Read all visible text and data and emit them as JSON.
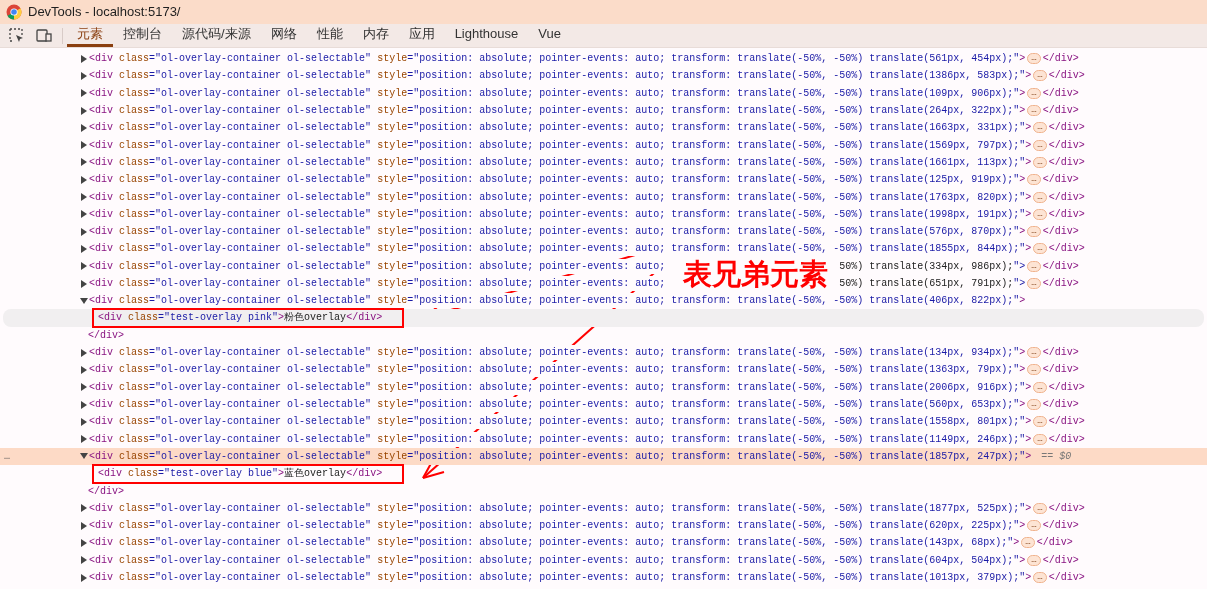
{
  "window": {
    "title": "DevTools - localhost:5173/"
  },
  "tabs": [
    {
      "label": "元素",
      "selected": true
    },
    {
      "label": "控制台",
      "selected": false
    },
    {
      "label": "源代码/来源",
      "selected": false
    },
    {
      "label": "网络",
      "selected": false
    },
    {
      "label": "性能",
      "selected": false
    },
    {
      "label": "内存",
      "selected": false
    },
    {
      "label": "应用",
      "selected": false
    },
    {
      "label": "Lighthouse",
      "selected": false
    },
    {
      "label": "Vue",
      "selected": false
    }
  ],
  "dom_rows": [
    {
      "kind": "element",
      "expanded": false,
      "selected": false,
      "text": "<div class=\"ol-overlay-container ol-selectable\" style=\"position: absolute; pointer-events: auto; transform: translate(-50%, -50%) translate(561px, 454px);\">",
      "badge": "…",
      "close": "</div>"
    },
    {
      "kind": "element",
      "expanded": false,
      "selected": false,
      "text": "<div class=\"ol-overlay-container ol-selectable\" style=\"position: absolute; pointer-events: auto; transform: translate(-50%, -50%) translate(1386px, 583px);\">",
      "badge": "…",
      "close": "</div>"
    },
    {
      "kind": "element",
      "expanded": false,
      "selected": false,
      "text": "<div class=\"ol-overlay-container ol-selectable\" style=\"position: absolute; pointer-events: auto; transform: translate(-50%, -50%) translate(109px, 906px);\">",
      "badge": "…",
      "close": "</div>"
    },
    {
      "kind": "element",
      "expanded": false,
      "selected": false,
      "text": "<div class=\"ol-overlay-container ol-selectable\" style=\"position: absolute; pointer-events: auto; transform: translate(-50%, -50%) translate(264px, 322px);\">",
      "badge": "…",
      "close": "</div>"
    },
    {
      "kind": "element",
      "expanded": false,
      "selected": false,
      "text": "<div class=\"ol-overlay-container ol-selectable\" style=\"position: absolute; pointer-events: auto; transform: translate(-50%, -50%) translate(1663px, 331px);\">",
      "badge": "…",
      "close": "</div>"
    },
    {
      "kind": "element",
      "expanded": false,
      "selected": false,
      "text": "<div class=\"ol-overlay-container ol-selectable\" style=\"position: absolute; pointer-events: auto; transform: translate(-50%, -50%) translate(1569px, 797px);\">",
      "badge": "…",
      "close": "</div>"
    },
    {
      "kind": "element",
      "expanded": false,
      "selected": false,
      "text": "<div class=\"ol-overlay-container ol-selectable\" style=\"position: absolute; pointer-events: auto; transform: translate(-50%, -50%) translate(1661px, 113px);\">",
      "badge": "…",
      "close": "</div>"
    },
    {
      "kind": "element",
      "expanded": false,
      "selected": false,
      "text": "<div class=\"ol-overlay-container ol-selectable\" style=\"position: absolute; pointer-events: auto; transform: translate(-50%, -50%) translate(125px, 919px);\">",
      "badge": "…",
      "close": "</div>"
    },
    {
      "kind": "element",
      "expanded": false,
      "selected": false,
      "text": "<div class=\"ol-overlay-container ol-selectable\" style=\"position: absolute; pointer-events: auto; transform: translate(-50%, -50%) translate(1763px, 820px);\">",
      "badge": "…",
      "close": "</div>"
    },
    {
      "kind": "element",
      "expanded": false,
      "selected": false,
      "text": "<div class=\"ol-overlay-container ol-selectable\" style=\"position: absolute; pointer-events: auto; transform: translate(-50%, -50%) translate(1998px, 191px);\">",
      "badge": "…",
      "close": "</div>"
    },
    {
      "kind": "element",
      "expanded": false,
      "selected": false,
      "text": "<div class=\"ol-overlay-container ol-selectable\" style=\"position: absolute; pointer-events: auto; transform: translate(-50%, -50%) translate(576px, 870px);\">",
      "badge": "…",
      "close": "</div>"
    },
    {
      "kind": "element",
      "expanded": false,
      "selected": false,
      "text": "<div class=\"ol-overlay-container ol-selectable\" style=\"position: absolute; pointer-events: auto; transform: translate(-50%, -50%) translate(1855px, 844px);\">",
      "badge": "…",
      "close": "</div>"
    },
    {
      "kind": "element",
      "expanded": false,
      "selected": false,
      "parts": [
        "<div class=\"ol-overlay-container ol-selectable\" style=\"position: absolute; pointer-events: auto;",
        "50%) translate(334px, 986px);\">"
      ],
      "badge": "…",
      "close": "</div>"
    },
    {
      "kind": "element",
      "expanded": false,
      "selected": false,
      "parts": [
        "<div class=\"ol-overlay-container ol-selectable\" style=\"position: absolute; pointer-events: auto;",
        "50%) translate(651px, 791px);\">"
      ],
      "badge": "…",
      "close": "</div>"
    },
    {
      "kind": "element",
      "expanded": true,
      "selected": false,
      "text": "<div class=\"ol-overlay-container ol-selectable\" style=\"position: absolute; pointer-events: auto; transform: translate(-50%, -50%) translate(406px, 822px);\">"
    },
    {
      "kind": "child",
      "hovered": true,
      "boxed": true,
      "text": "<div class=\"test-overlay pink\">粉色overlay</div>"
    },
    {
      "kind": "closing",
      "text": "</div>"
    },
    {
      "kind": "element",
      "expanded": false,
      "selected": false,
      "text": "<div class=\"ol-overlay-container ol-selectable\" style=\"position: absolute; pointer-events: auto; transform: translate(-50%, -50%) translate(134px, 934px);\">",
      "badge": "…",
      "close": "</div>"
    },
    {
      "kind": "element",
      "expanded": false,
      "selected": false,
      "text": "<div class=\"ol-overlay-container ol-selectable\" style=\"position: absolute; pointer-events: auto; transform: translate(-50%, -50%) translate(1363px, 79px);\">",
      "badge": "…",
      "close": "</div>"
    },
    {
      "kind": "element",
      "expanded": false,
      "selected": false,
      "text": "<div class=\"ol-overlay-container ol-selectable\" style=\"position: absolute; pointer-events: auto; transform: translate(-50%, -50%) translate(2006px, 916px);\">",
      "badge": "…",
      "close": "</div>"
    },
    {
      "kind": "element",
      "expanded": false,
      "selected": false,
      "text": "<div class=\"ol-overlay-container ol-selectable\" style=\"position: absolute; pointer-events: auto; transform: translate(-50%, -50%) translate(560px, 653px);\">",
      "badge": "…",
      "close": "</div>"
    },
    {
      "kind": "element",
      "expanded": false,
      "selected": false,
      "text": "<div class=\"ol-overlay-container ol-selectable\" style=\"position: absolute; pointer-events: auto; transform: translate(-50%, -50%) translate(1558px, 801px);\">",
      "badge": "…",
      "close": "</div>"
    },
    {
      "kind": "element",
      "expanded": false,
      "selected": false,
      "text": "<div class=\"ol-overlay-container ol-selectable\" style=\"position: absolute; pointer-events: auto; transform: translate(-50%, -50%) translate(1149px, 246px);\">",
      "badge": "…",
      "close": "</div>"
    },
    {
      "kind": "element",
      "expanded": true,
      "selected": true,
      "gutter": "…",
      "marker": "== $0",
      "text": "<div class=\"ol-overlay-container ol-selectable\" style=\"position: absolute; pointer-events: auto; transform: translate(-50%, -50%) translate(1857px, 247px);\">"
    },
    {
      "kind": "child",
      "hovered": false,
      "boxed": true,
      "text": "<div class=\"test-overlay blue\">蓝色overlay</div>"
    },
    {
      "kind": "closing",
      "text": "</div>"
    },
    {
      "kind": "element",
      "expanded": false,
      "selected": false,
      "text": "<div class=\"ol-overlay-container ol-selectable\" style=\"position: absolute; pointer-events: auto; transform: translate(-50%, -50%) translate(1877px, 525px);\">",
      "badge": "…",
      "close": "</div>"
    },
    {
      "kind": "element",
      "expanded": false,
      "selected": false,
      "text": "<div class=\"ol-overlay-container ol-selectable\" style=\"position: absolute; pointer-events: auto; transform: translate(-50%, -50%) translate(620px, 225px);\">",
      "badge": "…",
      "close": "</div>"
    },
    {
      "kind": "element",
      "expanded": false,
      "selected": false,
      "text": "<div class=\"ol-overlay-container ol-selectable\" style=\"position: absolute; pointer-events: auto; transform: translate(-50%, -50%) translate(143px, 68px);\">",
      "badge": "…",
      "close": "</div>"
    },
    {
      "kind": "element",
      "expanded": false,
      "selected": false,
      "text": "<div class=\"ol-overlay-container ol-selectable\" style=\"position: absolute; pointer-events: auto; transform: translate(-50%, -50%) translate(604px, 504px);\">",
      "badge": "…",
      "close": "</div>"
    },
    {
      "kind": "element",
      "expanded": false,
      "selected": false,
      "text": "<div class=\"ol-overlay-container ol-selectable\" style=\"position: absolute; pointer-events: auto; transform: translate(-50%, -50%) translate(1013px, 379px);\">",
      "badge": "…",
      "close": "</div>"
    }
  ],
  "annotation": {
    "label": "表兄弟元素"
  }
}
